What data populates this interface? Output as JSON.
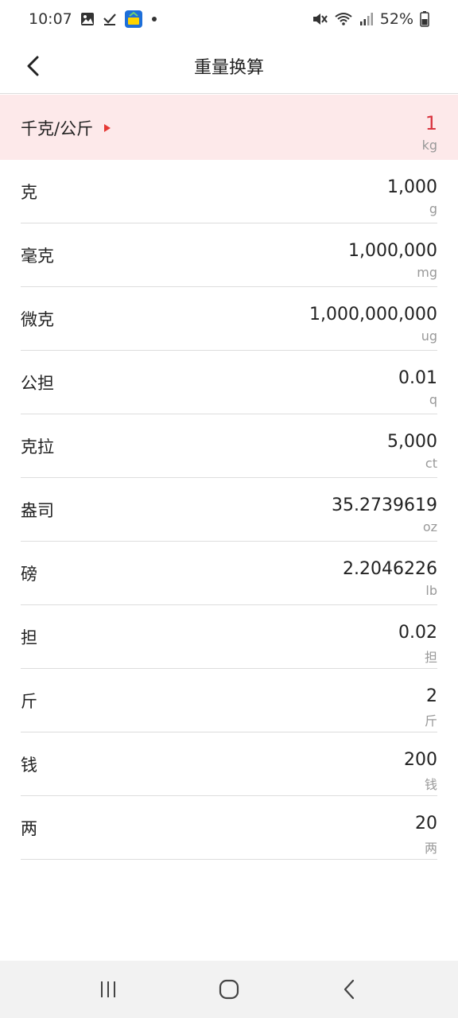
{
  "status": {
    "time": "10:07",
    "battery": "52%",
    "icons": [
      "image-icon",
      "checkmark-icon",
      "app-icon",
      "dot-icon",
      "mute-icon",
      "wifi-icon",
      "signal-icon",
      "battery-icon"
    ]
  },
  "header": {
    "title": "重量换算",
    "back_icon": "back-arrow-icon"
  },
  "selected": {
    "label": "千克/公斤",
    "value": "1",
    "unit": "kg",
    "accent_color": "#d9343f",
    "background": "#fde9ea"
  },
  "rows": [
    {
      "label": "克",
      "value": "1,000",
      "unit": "g"
    },
    {
      "label": "毫克",
      "value": "1,000,000",
      "unit": "mg"
    },
    {
      "label": "微克",
      "value": "1,000,000,000",
      "unit": "ug"
    },
    {
      "label": "公担",
      "value": "0.01",
      "unit": "q"
    },
    {
      "label": "克拉",
      "value": "5,000",
      "unit": "ct"
    },
    {
      "label": "盎司",
      "value": "35.2739619",
      "unit": "oz"
    },
    {
      "label": "磅",
      "value": "2.2046226",
      "unit": "lb"
    },
    {
      "label": "担",
      "value": "0.02",
      "unit": "担"
    },
    {
      "label": "斤",
      "value": "2",
      "unit": "斤"
    },
    {
      "label": "钱",
      "value": "200",
      "unit": "钱"
    },
    {
      "label": "两",
      "value": "20",
      "unit": "两"
    }
  ],
  "navigation": {
    "buttons": [
      "recent-apps-icon",
      "home-icon",
      "back-icon"
    ]
  }
}
